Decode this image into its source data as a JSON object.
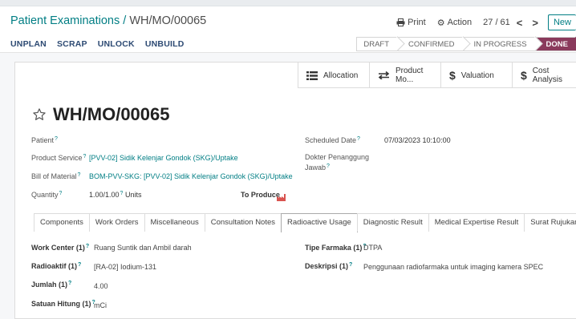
{
  "breadcrumb": {
    "parent": "Patient Examinations",
    "separator": " / ",
    "current": "WH/MO/00065"
  },
  "header": {
    "print_label": "Print",
    "action_label": "Action",
    "pager": "27 / 61",
    "new_label": "New"
  },
  "actions": [
    "UNPLAN",
    "SCRAP",
    "UNLOCK",
    "UNBUILD"
  ],
  "status_stages": [
    {
      "label": "DRAFT",
      "active": false
    },
    {
      "label": "CONFIRMED",
      "active": false
    },
    {
      "label": "IN PROGRESS",
      "active": false
    },
    {
      "label": "DONE",
      "active": true
    }
  ],
  "smart_buttons": {
    "allocation": "Allocation",
    "product_moves": "Product Mo...",
    "valuation": "Valuation",
    "cost_analysis": "Cost Analysis"
  },
  "record": {
    "name": "WH/MO/00065",
    "patient_label": "Patient",
    "patient_value": "",
    "product_service_label": "Product Service",
    "product_service_value": "[PVV-02] Sidik Kelenjar Gondok (SKG)/Uptake",
    "bom_label": "Bill of Material",
    "bom_value": "BOM-PVV-SKG: [PVV-02] Sidik Kelenjar Gondok (SKG)/Uptake",
    "quantity_label": "Quantity",
    "quantity_value": "1.00/1.00",
    "quantity_unit": "Units",
    "to_produce_label": "To Produce",
    "scheduled_date_label": "Scheduled Date",
    "scheduled_date_value": "07/03/2023 10:10:00",
    "doctor_label_line1": "Dokter Penanggung",
    "doctor_label_line2": "Jawab"
  },
  "help_mark": "?",
  "tabs": [
    {
      "label": "Components",
      "active": false
    },
    {
      "label": "Work Orders",
      "active": false
    },
    {
      "label": "Miscellaneous",
      "active": false
    },
    {
      "label": "Consultation Notes",
      "active": false
    },
    {
      "label": "Radioactive Usage",
      "active": true
    },
    {
      "label": "Diagnostic Result",
      "active": false
    },
    {
      "label": "Medical Expertise Result",
      "active": false
    },
    {
      "label": "Surat Rujukan Balik",
      "active": false
    }
  ],
  "radioactive": {
    "work_center_label": "Work Center (1)",
    "work_center_value": "Ruang Suntik dan Ambil darah",
    "radioaktif_label": "Radioaktif (1)",
    "radioaktif_value": "[RA-02] Iodium-131",
    "jumlah_label": "Jumlah (1)",
    "jumlah_value": "4.00",
    "satuan_label": "Satuan Hitung (1)",
    "satuan_value": "mCi",
    "tipe_label": "Tipe Farmaka (1)",
    "tipe_value": "DTPA",
    "deskripsi_label": "Deskripsi (1)",
    "deskripsi_value": "Penggunaan radiofarmaka untuk imaging kamera SPEC"
  },
  "colors": {
    "brand": "#017e84",
    "done_stage": "#8a3a5c",
    "warning_icon": "#d9534f"
  }
}
